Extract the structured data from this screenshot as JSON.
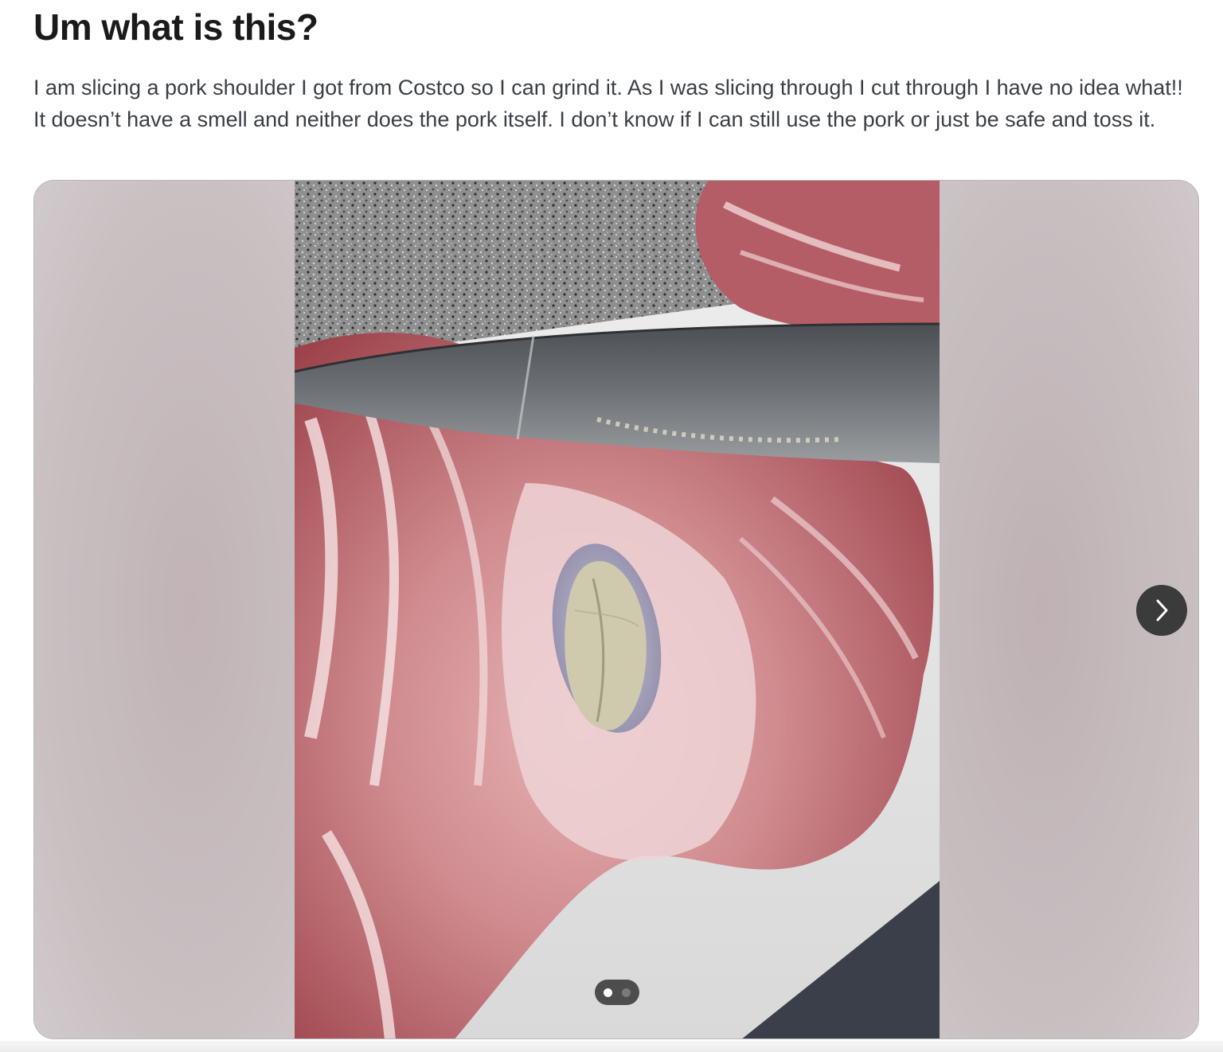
{
  "post": {
    "title": "Um what is this?",
    "body": "I am slicing a pork shoulder I got from Costco so I can grind it. As I was slicing through I cut through I have no idea what!! It doesn’t have a smell and neither does the pork itself. I don’t know if I can still use the pork or just be safe and toss it."
  },
  "gallery": {
    "image_count": 2,
    "current_index": 1,
    "next_icon": "chevron-right-icon"
  },
  "colors": {
    "title": "#1a1a1b",
    "body_text": "#3a3f44",
    "nav_button": "#3b3b3b",
    "dots_bg": "#1e1e1e"
  }
}
